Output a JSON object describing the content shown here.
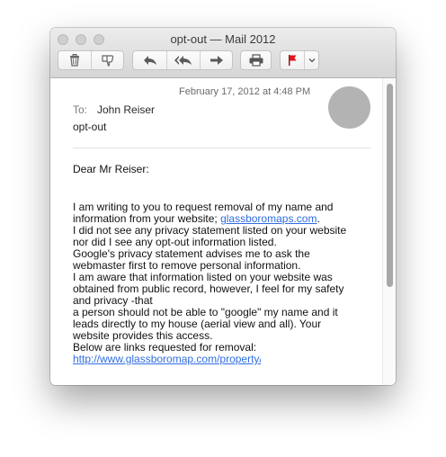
{
  "window": {
    "title": "opt-out — Mail 2012"
  },
  "toolbar": {
    "icons": [
      "trash-icon",
      "junk-icon",
      "reply-icon",
      "reply-all-icon",
      "forward-icon",
      "print-icon",
      "flag-icon",
      "chevron-down-icon"
    ],
    "flag_color": "#e0161b"
  },
  "message": {
    "date": "February 17, 2012 at 4:48 PM",
    "to_label": "To:",
    "to": "John Reiser",
    "subject": "opt-out",
    "greeting": "Dear Mr Reiser:",
    "body": {
      "line1": "I am writing to you to request removal of my name and",
      "line2_prefix": "information from your website; ",
      "line2_link": "glassboromaps.com",
      "line2_suffix": ".",
      "line3": "I did not see any privacy statement listed on your website",
      "line4": "nor did I see any opt-out information listed.",
      "line5": "Google's privacy statement advises me to ask the",
      "line6": "webmaster first to remove personal information.",
      "line7": "I am aware that information listed on your website was",
      "line8": "obtained from public record, however, I feel for my safety",
      "line9": "and privacy -that",
      "line10": "a person should not be able to \"google\" my name and it",
      "line11": "leads directly to my house (aerial view and all).  Your",
      "line12": "website provides this access.",
      "line13": "Below are links requested for removal:",
      "line14_link": "http://www.glassboromap.com/property/"
    }
  },
  "colors": {
    "link": "#2f6de1",
    "avatar": "#b3b3b3"
  }
}
